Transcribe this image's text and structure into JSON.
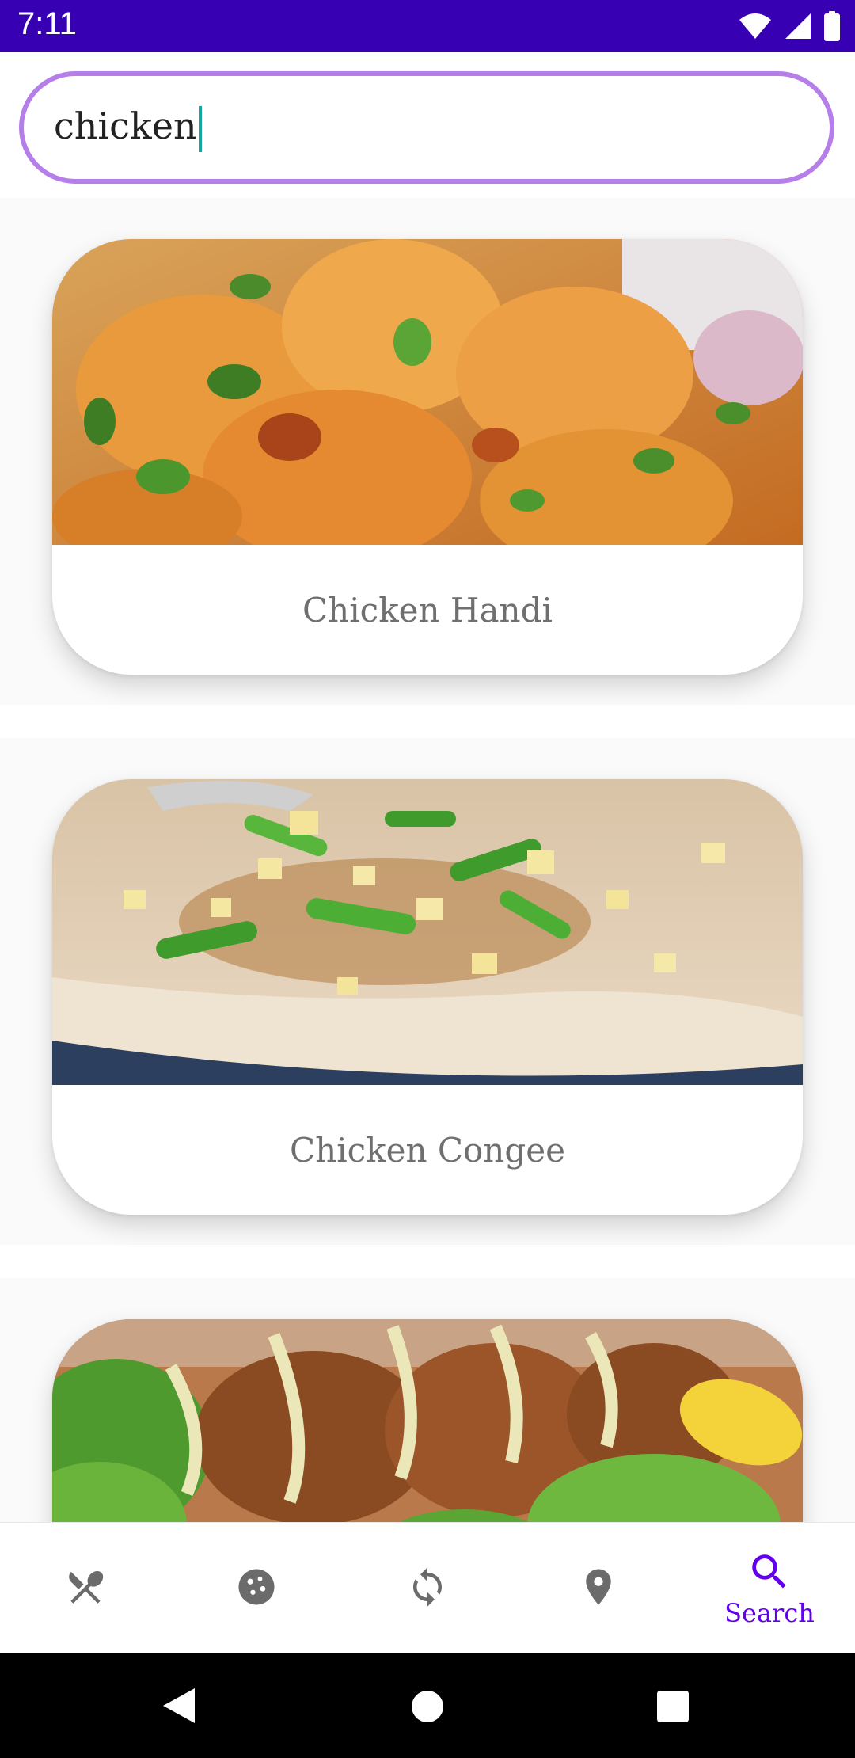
{
  "status_bar": {
    "time": "7:11"
  },
  "search": {
    "value": "chicken",
    "placeholder": ""
  },
  "results": [
    {
      "title": "Chicken Handi"
    },
    {
      "title": "Chicken Congee"
    },
    {
      "title": ""
    }
  ],
  "bottom_nav": {
    "items": [
      {
        "icon": "restaurant-icon",
        "label": ""
      },
      {
        "icon": "cookie-icon",
        "label": ""
      },
      {
        "icon": "refresh-icon",
        "label": ""
      },
      {
        "icon": "location-pin-icon",
        "label": ""
      },
      {
        "icon": "search-icon",
        "label": "Search"
      }
    ],
    "active_color": "#6200EE",
    "inactive_color": "#6b6b6b"
  },
  "colors": {
    "status_bar": "#3700B3",
    "search_border": "#B57EE8",
    "caret": "#16A6A0"
  }
}
